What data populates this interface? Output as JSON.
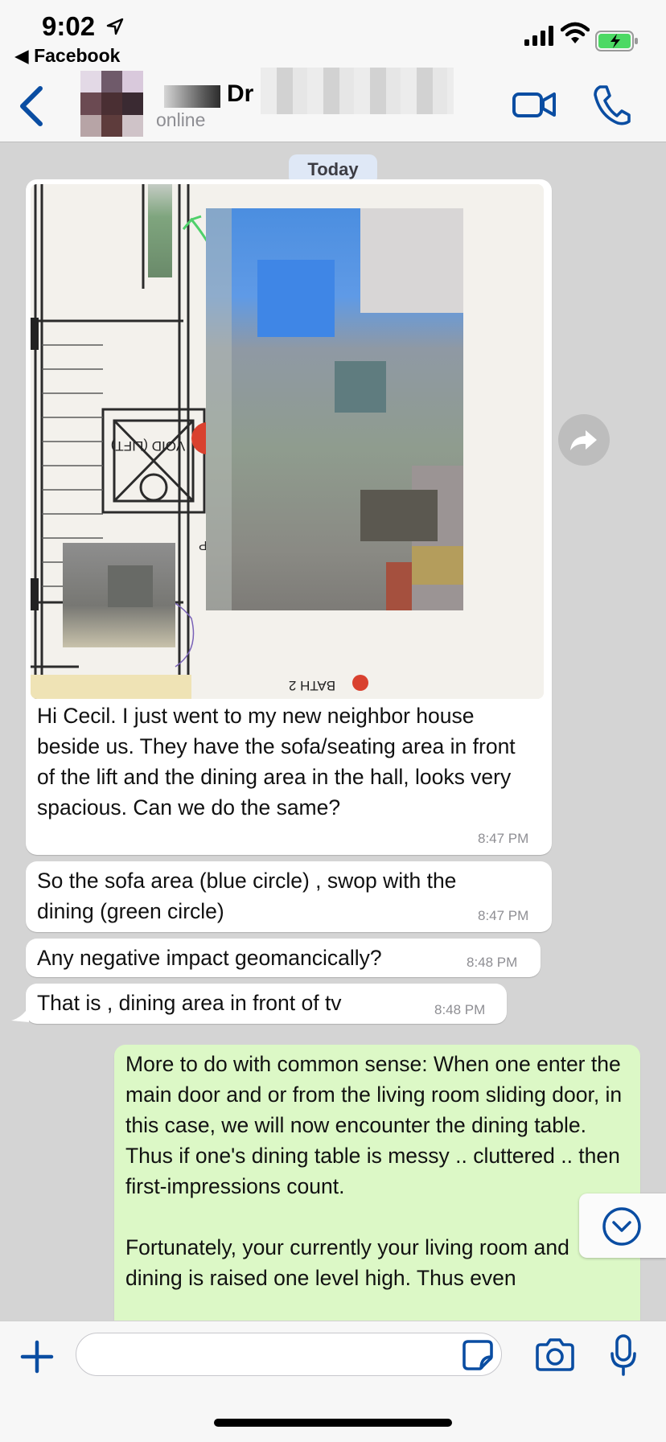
{
  "status_bar": {
    "time": "9:02",
    "back_app": "◀ Facebook"
  },
  "header": {
    "contact_name": "Dr",
    "presence": "online"
  },
  "chat": {
    "date_label": "Today",
    "messages": [
      {
        "direction": "incoming",
        "has_image": true,
        "text": "Hi Cecil. I just went to my new neighbor house beside us. They have the sofa/seating area in front of the lift and the dining area in the hall, looks very spacious. Can we do the same?",
        "time": "8:47 PM"
      },
      {
        "direction": "incoming",
        "text": "So the sofa area (blue circle) , swop with the dining (green circle)",
        "time": "8:47 PM"
      },
      {
        "direction": "incoming",
        "text": "Any negative impact geomancically?",
        "time": "8:48 PM"
      },
      {
        "direction": "incoming",
        "text": "That is , dining area in front of tv",
        "time": "8:48 PM"
      },
      {
        "direction": "outgoing",
        "text": "More to do with common sense: When one enter the main door and or from the living room sliding door, in this case, we will now encounter the dining table. Thus if one's dining table is messy .. cluttered .. then first-impressions count.\n\nFortunately, your currently your living room and dining is raised one level high. Thus even"
      }
    ],
    "floorplan_labels": [
      "VOID (LIFT)",
      "UP",
      "BATH 2"
    ]
  },
  "input_bar": {
    "placeholder": ""
  },
  "colors": {
    "accent": "#0a4da2",
    "incoming_bubble": "#ffffff",
    "outgoing_bubble": "#dcf8c6",
    "chat_background": "#d4d4d4"
  },
  "icons": [
    "location-arrow-icon",
    "signal-icon",
    "wifi-icon",
    "battery-icon",
    "back-chevron-icon",
    "video-call-icon",
    "phone-call-icon",
    "forward-icon",
    "chevron-down-icon",
    "plus-icon",
    "sticker-icon",
    "camera-icon",
    "microphone-icon"
  ]
}
